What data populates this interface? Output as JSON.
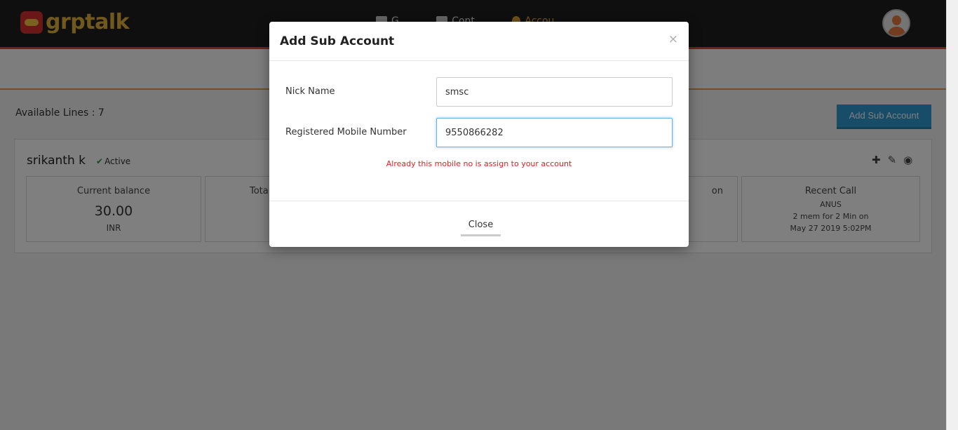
{
  "app": {
    "logo_text": "grptalk"
  },
  "nav": [
    {
      "label": "G...",
      "icon": "groups-icon"
    },
    {
      "label": "Cont...",
      "icon": "contacts-icon"
    },
    {
      "label": "Accou...",
      "icon": "account-icon"
    }
  ],
  "page": {
    "available_lines_label": "Available Lines : 7",
    "add_sub_account_label": "Add Sub Account"
  },
  "account_card": {
    "name": "srikanth k",
    "status": "Active",
    "stats": [
      {
        "title": "Current balance",
        "value": "30.00",
        "unit": "INR"
      },
      {
        "title": "Tota",
        "value": "",
        "unit": ""
      },
      {
        "title": "on",
        "value": "",
        "unit": ""
      },
      {
        "title": "Recent Call",
        "lines": [
          "ANUS",
          "2 mem for 2 Min on",
          "May 27 2019 5:02PM"
        ]
      }
    ]
  },
  "modal": {
    "title": "Add Sub Account",
    "close_x": "×",
    "nick_name_label": "Nick Name",
    "nick_name_value": "smsc",
    "mobile_label": "Registered Mobile Number",
    "mobile_value": "9550866282",
    "error_text": "Already this mobile no is assign to your account",
    "close_button_label": "Close"
  },
  "colors": {
    "header_bg": "#1e1e1e",
    "accent_red": "#e0452b",
    "primary_button": "#2e9ad0",
    "error": "#e02020",
    "active_green": "#2a9d3a"
  }
}
